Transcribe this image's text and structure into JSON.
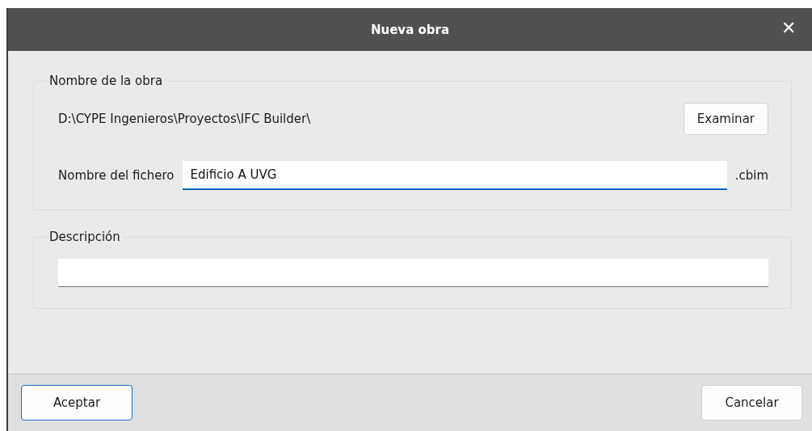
{
  "window": {
    "title": "Nueva obra",
    "close": "✕"
  },
  "groups": [
    {
      "title": "Nombre de la obra",
      "path": "D:\\CYPE Ingenieros\\Proyectos\\IFC Builder\\",
      "browse_button": "Examinar",
      "file_label": "Nombre del fichero",
      "file_field": {
        "value": "Edificio A UVG",
        "focused": true
      },
      "extension": ".cbim"
    },
    {
      "title": "Descripción",
      "field": {
        "focused": false
      }
    }
  ],
  "buttons": [
    {
      "label": "Aceptar",
      "default": true
    },
    {
      "label": "Cancelar",
      "default": false
    }
  ]
}
